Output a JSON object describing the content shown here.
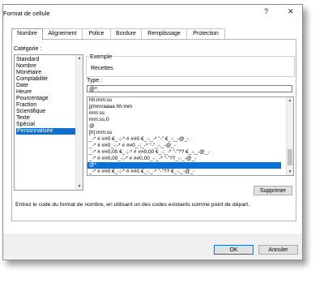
{
  "window": {
    "title": "Format de cellule",
    "help_label": "?",
    "close_label": "✕"
  },
  "tabs": [
    "Nombre",
    "Alignement",
    "Police",
    "Bordure",
    "Remplissage",
    "Protection"
  ],
  "category": {
    "label": "Catégorie :",
    "items": [
      "Standard",
      "Nombre",
      "Monétaire",
      "Comptabilité",
      "Date",
      "Heure",
      "Pourcentage",
      "Fraction",
      "Scientifique",
      "Texte",
      "Spécial",
      "Personnalisée"
    ],
    "selected": "Personnalisée"
  },
  "sample": {
    "group_label": "Exemple",
    "value": "Recettes"
  },
  "type": {
    "label": "Type :",
    "value": "@*.",
    "formats": [
      "hh:mm:ss",
      "jj/mm/aaaa hh:mm",
      "mm:ss",
      "mm:ss,0",
      "@",
      "[h]:mm:ss",
      "_-* # ##0 €_-;-* # ##0 €_-;_-* \"-\" €_-;_-@_-",
      "_-* # ##0_-;-* # ##0_-;_-* \"-\"_-;_-@_-",
      "_-* # ##0,00 €_-;-* # ##0,00 €_-;_-* \"-\"?? €_-;_-@_-",
      "_-* # ##0,00_-;-* # ##0,00_-;_-* \"-\"??_-;_-@_-",
      "@*.",
      "_-* # ##0 €_-;-* # ##0 €_-;_-* \"-\"?? €_-;_-@_-"
    ],
    "selected": "@*."
  },
  "delete_button": "Supprimer",
  "hint": "Entrez le code du format de nombre, en utilisant un des codes existants comme point de départ.",
  "ok_button": "OK",
  "cancel_button": "Annuler"
}
